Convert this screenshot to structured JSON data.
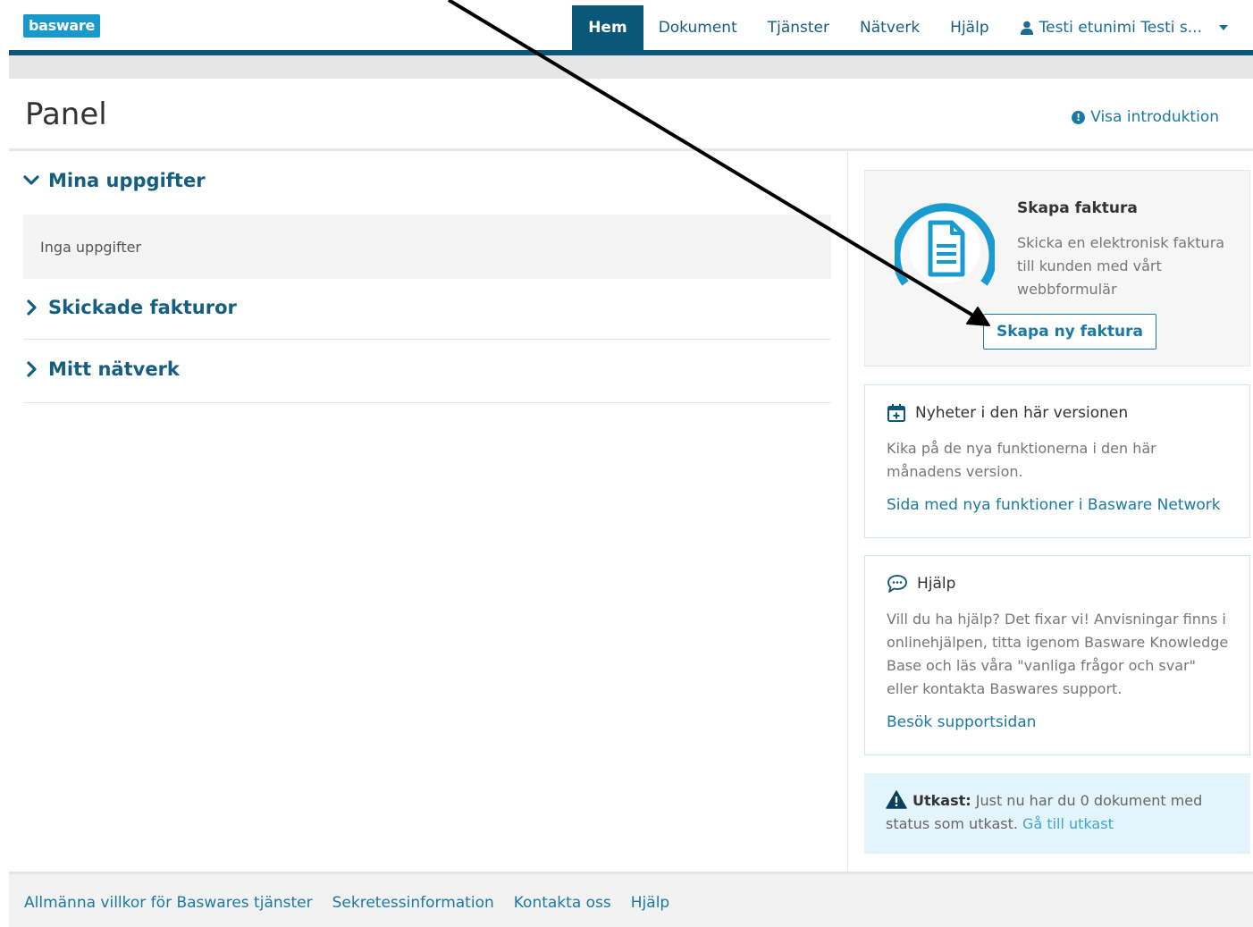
{
  "header": {
    "logo_text": "basware",
    "nav": [
      {
        "label": "Hem",
        "active": true
      },
      {
        "label": "Dokument"
      },
      {
        "label": "Tjänster"
      },
      {
        "label": "Nätverk"
      },
      {
        "label": "Hjälp"
      }
    ],
    "user_label": "Testi etunimi Testi s..."
  },
  "page": {
    "title": "Panel",
    "intro_link": "Visa introduktion"
  },
  "left": {
    "tasks_title": "Mina uppgifter",
    "tasks_empty": "Inga uppgifter",
    "sent_title": "Skickade fakturor",
    "network_title": "Mitt nätverk"
  },
  "create_invoice": {
    "title": "Skapa faktura",
    "description": "Skicka en elektronisk faktura till kunden med vårt webbformulär",
    "button": "Skapa ny faktura"
  },
  "news": {
    "title": "Nyheter i den här versionen",
    "text": "Kika på de nya funktionerna i den här månadens version.",
    "link": "Sida med nya funktioner i Basware Network"
  },
  "help": {
    "title": "Hjälp",
    "text": "Vill du ha hjälp? Det fixar vi! Anvisningar finns i onlinehjälpen, titta igenom Basware Knowledge Base och läs våra \"vanliga frågor och svar\" eller kontakta Baswares support.",
    "link": "Besök supportsidan"
  },
  "draft": {
    "label": "Utkast:",
    "text": "Just nu har du 0 dokument med status som utkast.",
    "link": "Gå till utkast"
  },
  "footer": {
    "links": [
      "Allmänna villkor för Baswares tjänster",
      "Sekretessinformation",
      "Kontakta oss",
      "Hjälp"
    ]
  },
  "colors": {
    "brand_dark": "#0b5779",
    "link": "#1a7aa3",
    "logo": "#1899c9",
    "icon_ring": "#1a9bd0"
  }
}
